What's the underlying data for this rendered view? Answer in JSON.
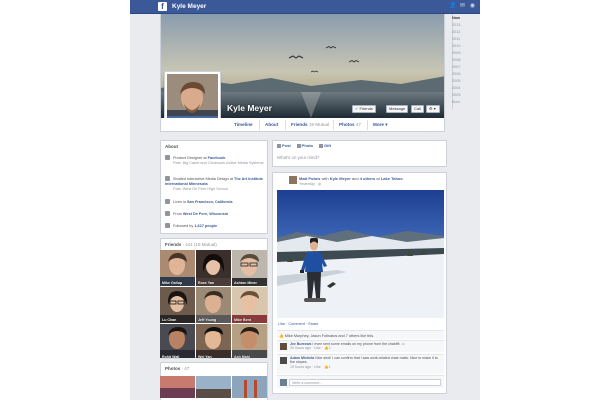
{
  "topbar": {
    "name": "Kyle Meyer"
  },
  "profile": {
    "name": "Kyle Meyer"
  },
  "cover_buttons": {
    "friends": "✓ Friends",
    "message": "Message",
    "call": "Call"
  },
  "tabs": [
    {
      "label": "Timeline"
    },
    {
      "label": "About"
    },
    {
      "label": "Friends",
      "sub": "19 Mutual"
    },
    {
      "label": "Photos",
      "sub": "47"
    },
    {
      "label": "More ▾"
    }
  ],
  "years": [
    "Now",
    "2013",
    "2012",
    "2011",
    "2010",
    "2009",
    "2008",
    "2007",
    "2006",
    "2005",
    "2004",
    "2003",
    "Born"
  ],
  "about": {
    "title": "About",
    "rows": [
      {
        "pre": "Product Designer at ",
        "link": "Facebook",
        "sub": "Past: Big Cartel and Clockwork Active Media Systems"
      },
      {
        "pre": "Studied Interactive Media Design at ",
        "link": "The Art Institute International Minnesota",
        "sub": "Past: West De Pere High School"
      },
      {
        "pre": "Lives in ",
        "link": "San Francisco, California",
        "sub": ""
      },
      {
        "pre": "From ",
        "link": "West De Pere, Wisconsin",
        "sub": ""
      },
      {
        "pre": "Followed by ",
        "link": "1,627 people",
        "sub": ""
      }
    ]
  },
  "friends": {
    "title": "Friends",
    "sub": "· 441 (19 Mutual)",
    "people": [
      {
        "name": "Mike Gallup",
        "color": "#8a6a52"
      },
      {
        "name": "Rose Yan",
        "color": "#3a2f2b"
      },
      {
        "name": "Ashton Miner",
        "color": "#a8a29b"
      },
      {
        "name": "Lu Chan",
        "color": "#5c4a3e"
      },
      {
        "name": "Jeff Young",
        "color": "#8a7a66"
      },
      {
        "name": "Mike Bent",
        "color": "#c7b39c"
      },
      {
        "name": "Rohit Wali",
        "color": "#3e3c40"
      },
      {
        "name": "Wei Yan",
        "color": "#6a4f3c"
      },
      {
        "name": "Ash Mahi",
        "color": "#a58e73"
      }
    ]
  },
  "photos": {
    "title": "Photos",
    "sub": "· 47"
  },
  "composer": {
    "tabs": [
      "Post",
      "Photo",
      "Gift"
    ],
    "placeholder": "What's on your mind?"
  },
  "story": {
    "author": "Matt Pobes",
    "with_pre": " with ",
    "with": "Kyle Meyer",
    "and": " and ",
    "others": "4 others",
    "at": " at ",
    "place": "Lake Tahoe.",
    "time": "Yesterday ·",
    "actions": "Like · Comment · Share",
    "likes": "Mike Murphey, Jason Fotinatos and 7 others like this.",
    "comments": [
      {
        "name": "Jez Burrows",
        "text": " I even sent some emails on my phone from the chairlift. ",
        "meta": "20 hours ago · Like · ",
        "likes": "1",
        "color": "#5f4d3d"
      },
      {
        "name": "Adam Michela",
        "text": " Nice shot! I can confirm that I saw work-related chair mails. Nice to make it to the slopes.",
        "meta": "19 hours ago · Like · ",
        "likes": "1",
        "color": "#4d4a4a"
      }
    ],
    "write_placeholder": "Write a comment..."
  },
  "colors": {
    "brand": "#3b5998",
    "page_bg": "#e9ebee"
  }
}
